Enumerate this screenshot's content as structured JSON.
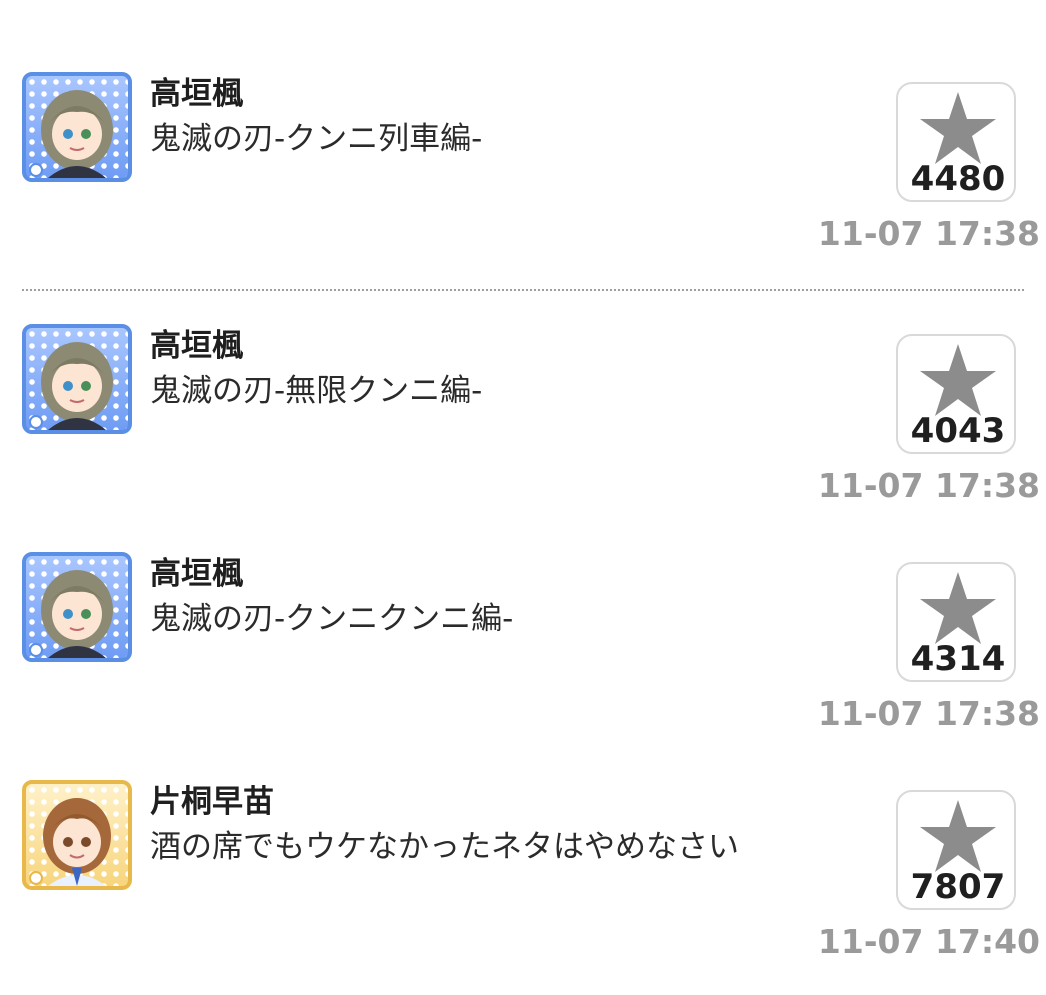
{
  "posts": [
    {
      "author": "高垣楓",
      "message": "鬼滅の刃-クンニ列車編-",
      "stars": "4480",
      "time": "11-07 17:38",
      "avatar_frame": "blue",
      "star_icon": "star-icon"
    },
    {
      "author": "高垣楓",
      "message": "鬼滅の刃-無限クンニ編-",
      "stars": "4043",
      "time": "11-07 17:38",
      "avatar_frame": "blue",
      "star_icon": "star-icon"
    },
    {
      "author": "高垣楓",
      "message": "鬼滅の刃-クンニクンニ編-",
      "stars": "4314",
      "time": "11-07 17:38",
      "avatar_frame": "blue",
      "star_icon": "star-icon"
    },
    {
      "author": "片桐早苗",
      "message": "酒の席でもウケなかったネタはやめなさい",
      "stars": "7807",
      "time": "11-07 17:40",
      "avatar_frame": "gold",
      "star_icon": "star-icon"
    }
  ],
  "colors": {
    "star": "#8c8c8c",
    "timestamp": "#9a9a9a",
    "blue_frame": "#5b8fe6",
    "gold_frame": "#e8b94a"
  }
}
